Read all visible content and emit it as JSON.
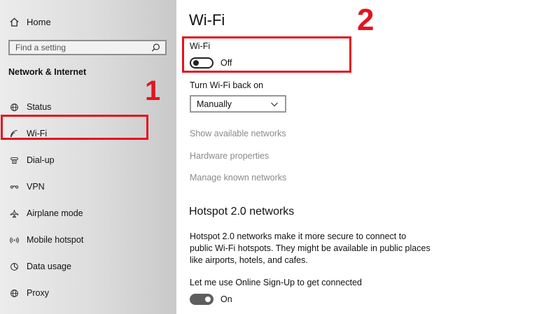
{
  "sidebar": {
    "home_label": "Home",
    "home_icon": "home-icon",
    "search_placeholder": "Find a setting",
    "search_icon": "search-icon",
    "section_title": "Network & Internet",
    "items": [
      {
        "label": "Status",
        "icon": "globe-icon"
      },
      {
        "label": "Wi-Fi",
        "icon": "wifi-icon"
      },
      {
        "label": "Dial-up",
        "icon": "phone-icon"
      },
      {
        "label": "VPN",
        "icon": "vpn-icon"
      },
      {
        "label": "Airplane mode",
        "icon": "airplane-icon"
      },
      {
        "label": "Mobile hotspot",
        "icon": "hotspot-icon"
      },
      {
        "label": "Data usage",
        "icon": "data-usage-icon"
      },
      {
        "label": "Proxy",
        "icon": "globe-icon"
      }
    ]
  },
  "annotations": {
    "marker_1": "1",
    "marker_2": "2",
    "highlight_color": "#e3141f"
  },
  "main": {
    "page_title": "Wi-Fi",
    "wifi_toggle_label": "Wi-Fi",
    "wifi_toggle_state": "Off",
    "turn_back_on_label": "Turn Wi-Fi back on",
    "turn_back_on_value": "Manually",
    "links": [
      "Show available networks",
      "Hardware properties",
      "Manage known networks"
    ],
    "hotspot_title": "Hotspot 2.0 networks",
    "hotspot_description": "Hotspot 2.0 networks make it more secure to connect to public Wi-Fi hotspots. They might be available in public places like airports, hotels, and cafes.",
    "signup_label": "Let me use Online Sign-Up to get connected",
    "signup_toggle_state": "On"
  }
}
